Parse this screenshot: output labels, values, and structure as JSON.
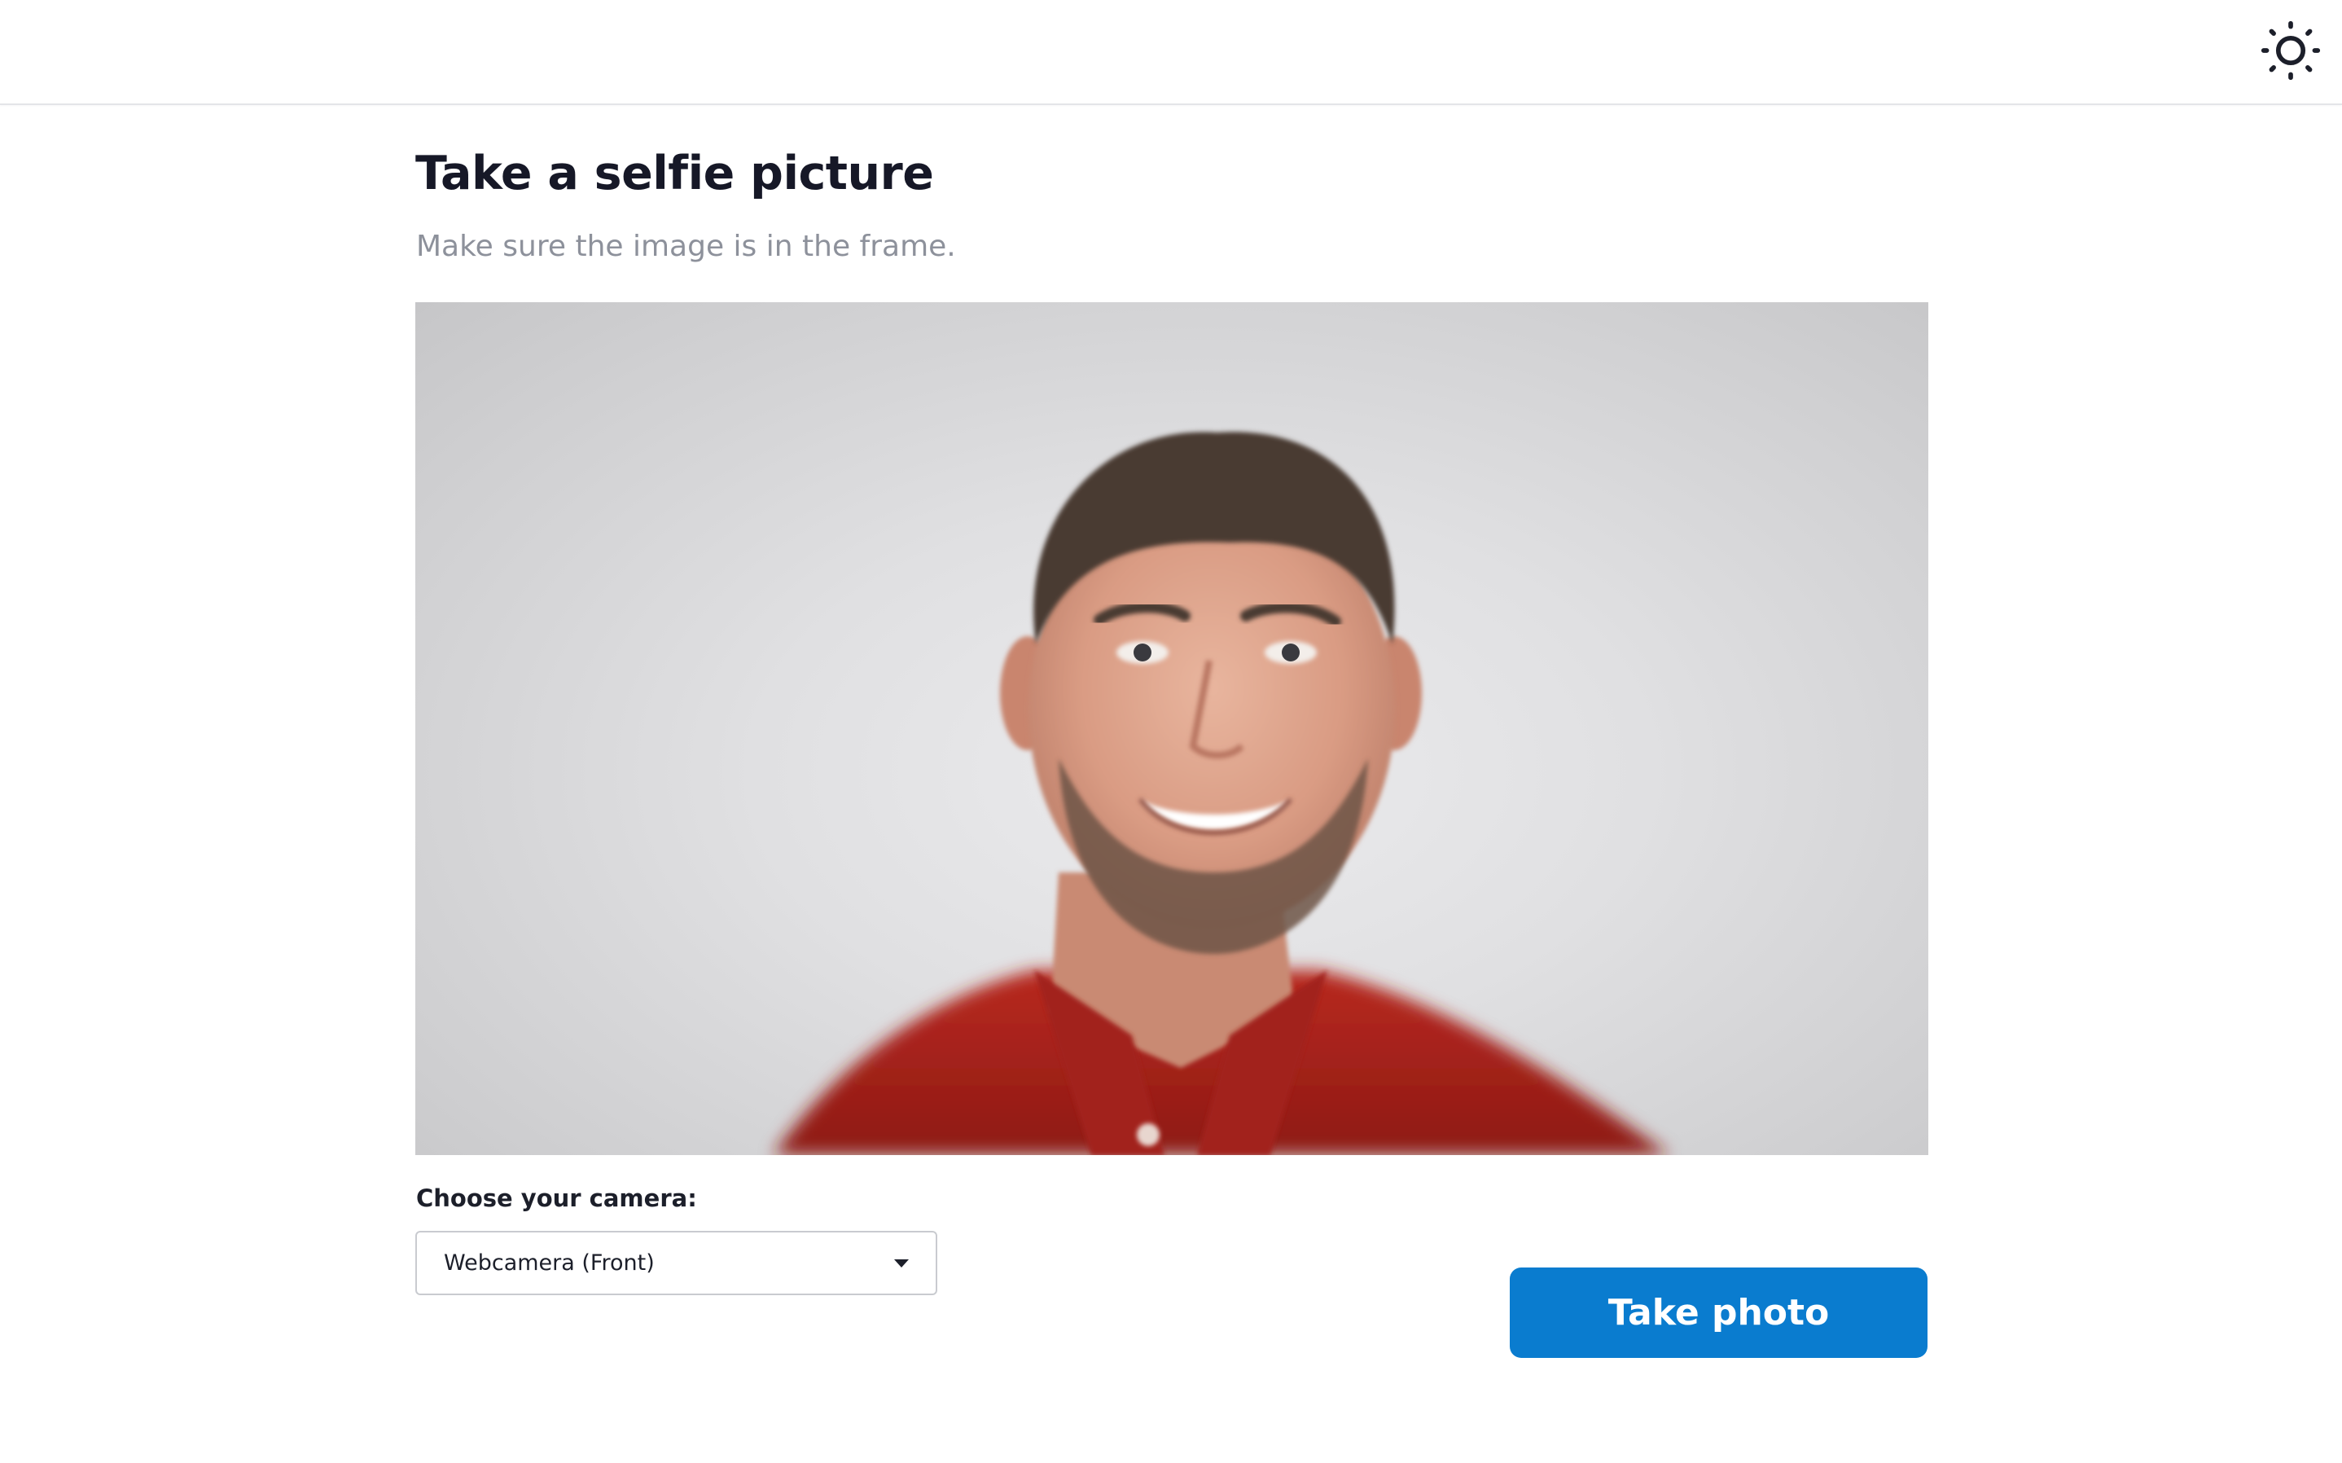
{
  "header": {
    "theme_toggle_icon": "sun-icon"
  },
  "main": {
    "title": "Take a selfie picture",
    "subtitle": "Make sure the image is in the frame.",
    "camera_preview_alt": "Camera preview"
  },
  "camera": {
    "label": "Choose your camera:",
    "selected": "Webcamera (Front)",
    "dropdown_icon": "caret-down-icon"
  },
  "actions": {
    "take_photo_label": "Take photo"
  },
  "colors": {
    "accent": "#0a7ccf",
    "title": "#161827",
    "subtitle": "#8d919b",
    "shirt": "#b2241f"
  }
}
